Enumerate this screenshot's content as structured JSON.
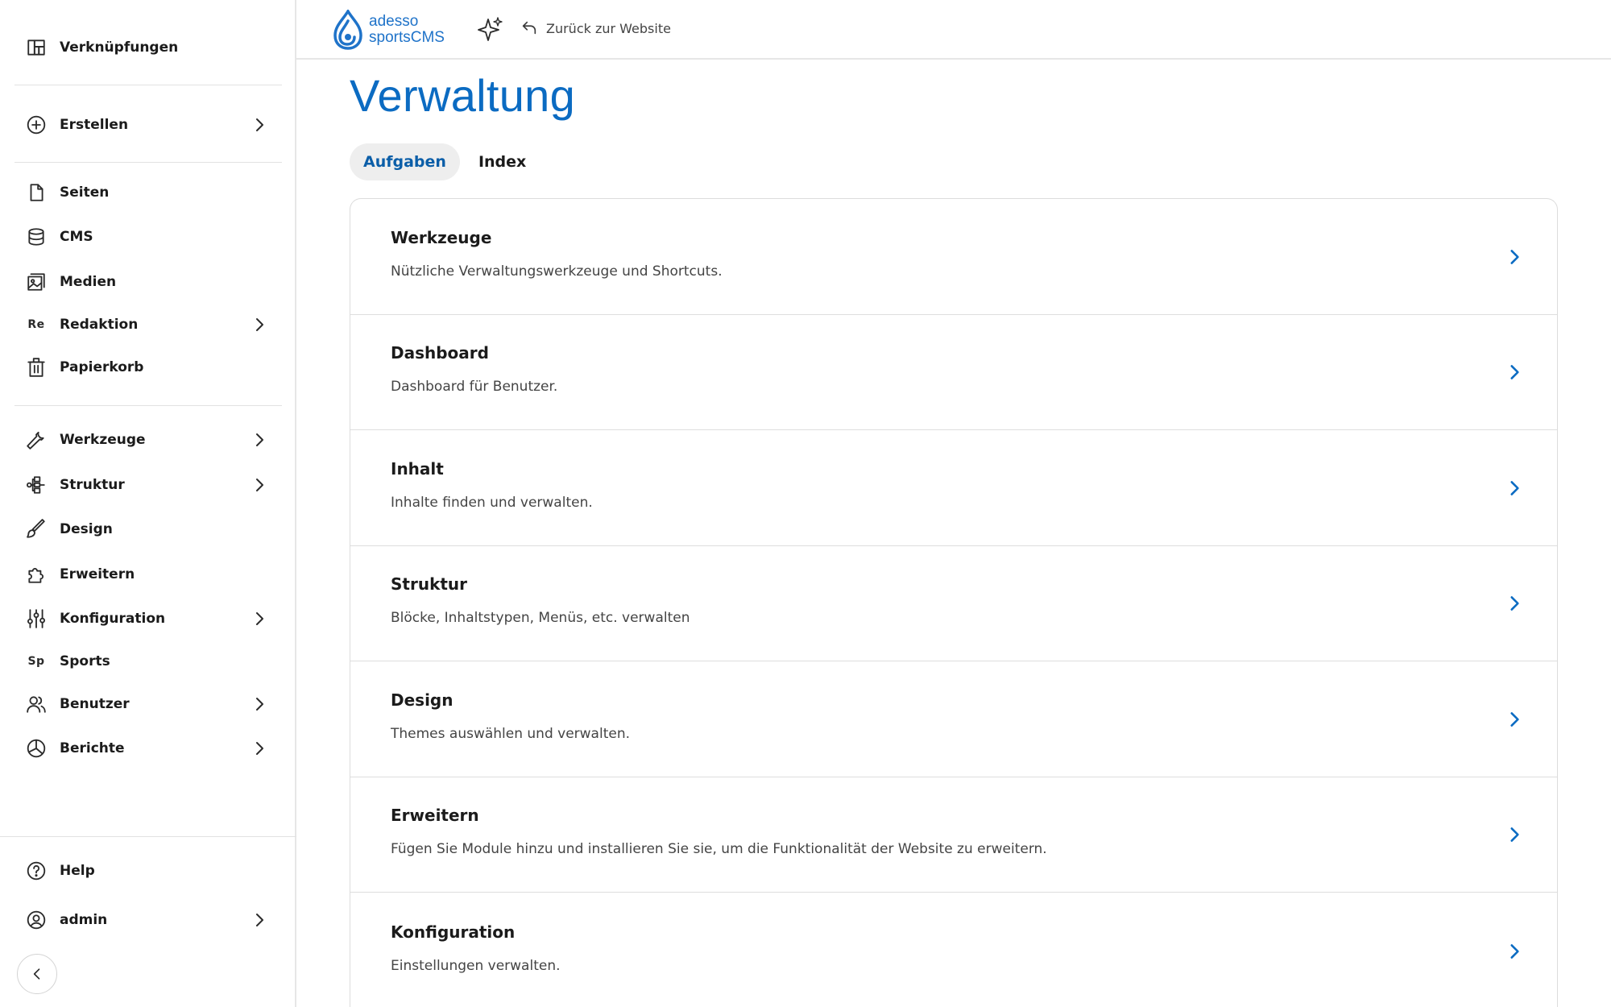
{
  "sidebar": {
    "shortcuts": {
      "label": "Verknüpfungen",
      "icon": "shortcuts-icon"
    },
    "create": {
      "label": "Erstellen",
      "icon": "plus-circle-icon"
    },
    "content_items": [
      {
        "label": "Seiten",
        "icon": "page-icon"
      },
      {
        "label": "CMS",
        "icon": "database-icon"
      },
      {
        "label": "Medien",
        "icon": "media-icon"
      },
      {
        "label": "Redaktion",
        "abbr": "Re"
      },
      {
        "label": "Papierkorb",
        "icon": "trash-icon"
      }
    ],
    "admin_items": [
      {
        "label": "Werkzeuge",
        "icon": "wrench-icon"
      },
      {
        "label": "Struktur",
        "icon": "structure-icon"
      },
      {
        "label": "Design",
        "icon": "brush-icon"
      },
      {
        "label": "Erweitern",
        "icon": "puzzle-icon"
      },
      {
        "label": "Konfiguration",
        "icon": "sliders-icon"
      },
      {
        "label": "Sports",
        "abbr": "Sp"
      },
      {
        "label": "Benutzer",
        "icon": "users-icon"
      },
      {
        "label": "Berichte",
        "icon": "chart-pie-icon"
      }
    ],
    "help": {
      "label": "Help",
      "icon": "help-icon"
    },
    "user": {
      "label": "admin",
      "icon": "user-circle-icon"
    }
  },
  "topbar": {
    "logo_line1": "adesso",
    "logo_line2": "sportsCMS",
    "back_link": "Zurück zur Website"
  },
  "main": {
    "title": "Verwaltung",
    "tabs": [
      {
        "label": "Aufgaben",
        "active": true
      },
      {
        "label": "Index",
        "active": false
      }
    ],
    "cards": [
      {
        "title": "Werkzeuge",
        "description": "Nützliche Verwaltungswerkzeuge und Shortcuts."
      },
      {
        "title": "Dashboard",
        "description": "Dashboard für Benutzer."
      },
      {
        "title": "Inhalt",
        "description": "Inhalte finden und verwalten."
      },
      {
        "title": "Struktur",
        "description": "Blöcke, Inhaltstypen, Menüs, etc. verwalten"
      },
      {
        "title": "Design",
        "description": "Themes auswählen und verwalten."
      },
      {
        "title": "Erweitern",
        "description": "Fügen Sie Module hinzu und installieren Sie sie, um die Funktionalität der Website zu erweitern."
      },
      {
        "title": "Konfiguration",
        "description": "Einstellungen verwalten."
      }
    ]
  },
  "colors": {
    "accent": "#0b6bc2",
    "text": "#1b1b1b",
    "border": "#dcdcdc"
  }
}
